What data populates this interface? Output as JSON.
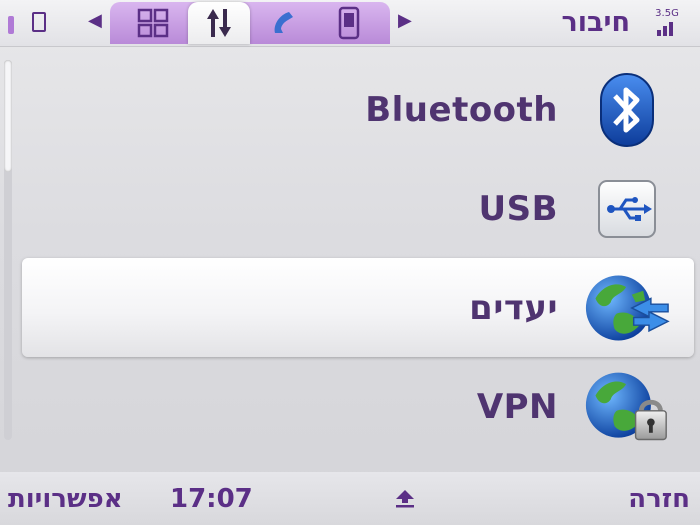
{
  "header": {
    "title": "חיבור",
    "signal_text": "3.5G",
    "tabs": [
      {
        "name": "apps-grid",
        "active": false
      },
      {
        "name": "connectivity",
        "active": true
      },
      {
        "name": "phone",
        "active": false
      },
      {
        "name": "device",
        "active": false
      }
    ]
  },
  "list": {
    "items": [
      {
        "label": "Bluetooth",
        "icon": "bluetooth-icon",
        "selected": false
      },
      {
        "label": "USB",
        "icon": "usb-icon",
        "selected": false
      },
      {
        "label": "יעדים",
        "icon": "destinations-globe-icon",
        "selected": true
      },
      {
        "label": "VPN",
        "icon": "vpn-globe-lock-icon",
        "selected": false
      }
    ]
  },
  "footer": {
    "left_softkey": "אפשרויות",
    "time": "17:07",
    "right_softkey": "חזרה"
  },
  "colors": {
    "accent": "#5b2f86",
    "tab_purple": "#c8a0e4",
    "bluetooth_blue": "#1b57c4"
  }
}
